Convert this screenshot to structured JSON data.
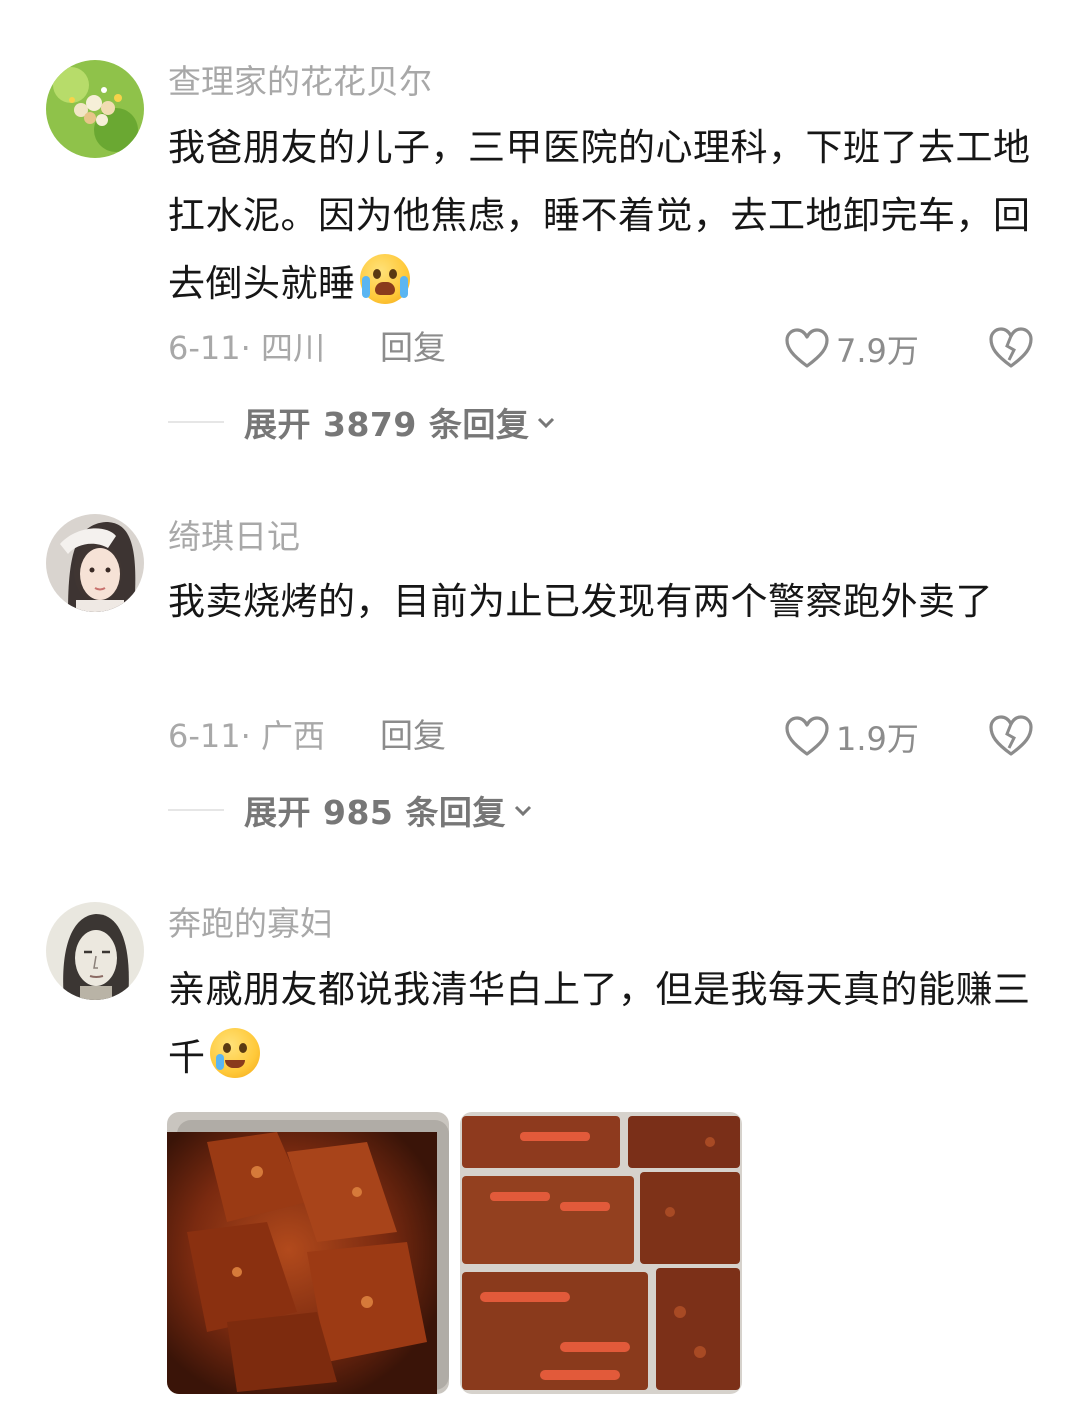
{
  "comments": [
    {
      "username": "查理家的花花贝尔",
      "text": "我爸朋友的儿子，三甲医院的心理科，下班了去工地扛水泥。因为他焦虑，睡不着觉，去工地卸完车，回去倒头就睡",
      "emoji": "crying-laughing-emoji",
      "date_location": "6-11· 四川",
      "reply_label": "回复",
      "likes": "7.9万",
      "expand_label": "展开 3879 条回复"
    },
    {
      "username": "绮琪日记",
      "text": "我卖烧烤的，目前为止已发现有两个警察跑外卖了",
      "date_location": "6-11· 广西",
      "reply_label": "回复",
      "likes": "1.9万",
      "expand_label": "展开 985 条回复"
    },
    {
      "username": "奔跑的寡妇",
      "text": "亲戚朋友都说我清华白上了，但是我每天真的能赚三千",
      "emoji": "tearful-smile-emoji",
      "images": [
        "braised-duck-wings-photo",
        "braised-food-trays-photo"
      ]
    }
  ],
  "colors": {
    "text": "#161616",
    "muted": "#a8a8a8",
    "icon": "#8c8c8c"
  }
}
